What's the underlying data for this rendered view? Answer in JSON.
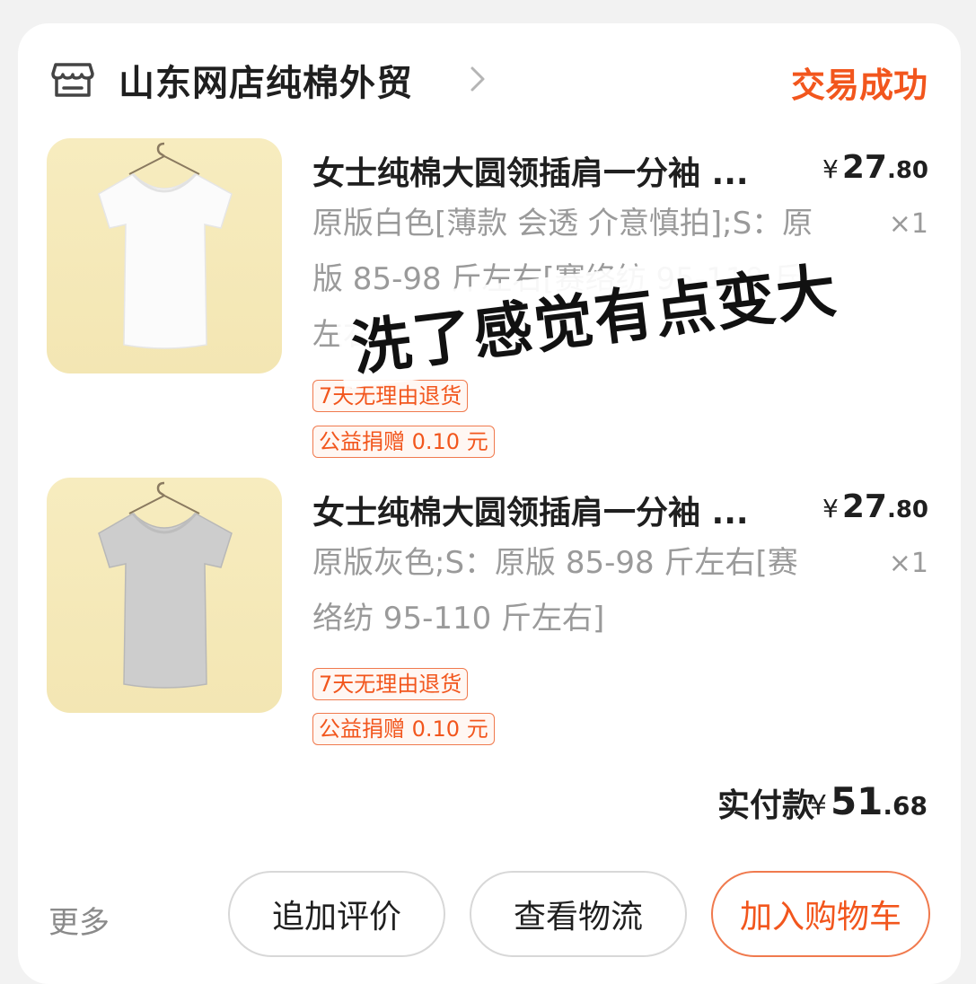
{
  "header": {
    "store_icon": "store-icon",
    "store_name": "山东网店纯棉外贸",
    "status": "交易成功"
  },
  "items": [
    {
      "title": "女士纯棉大圆领插肩一分袖 ...",
      "price_currency": "¥",
      "price_int": "27",
      "price_dec": ".80",
      "spec": "原版白色[薄款 会透 介意慎拍];S：原版 85-98 斤左右[赛络纺 95-110 斤左右]",
      "qty": "×1",
      "tags": [
        "7天无理由退货",
        "公益捐赠 0.10 元"
      ],
      "image": "white-tshirt"
    },
    {
      "title": "女士纯棉大圆领插肩一分袖 ...",
      "price_currency": "¥",
      "price_int": "27",
      "price_dec": ".80",
      "spec": "原版灰色;S：原版 85-98 斤左右[赛络纺 95-110 斤左右]",
      "qty": "×1",
      "tags": [
        "7天无理由退货",
        "公益捐赠 0.10 元"
      ],
      "image": "gray-tshirt"
    }
  ],
  "overlay_comment": "洗了感觉有点变大",
  "total": {
    "label": "实付款",
    "currency": "¥",
    "int": "51",
    "dec": ".68"
  },
  "footer": {
    "more": "更多",
    "buttons": [
      "追加评价",
      "查看物流",
      "加入购物车"
    ]
  },
  "colors": {
    "accent": "#f2561d",
    "text": "#1f1f1f",
    "muted": "#9a9a9a"
  }
}
